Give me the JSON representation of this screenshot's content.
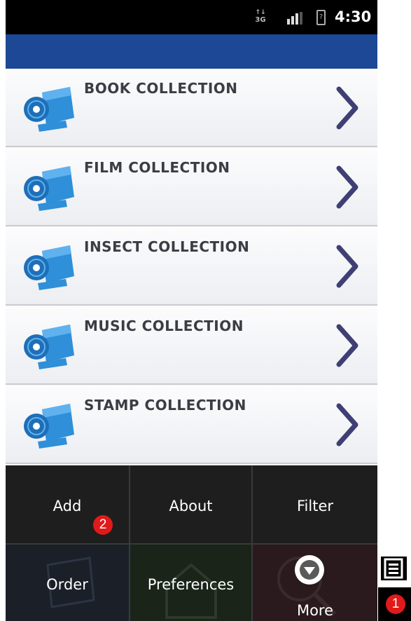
{
  "status_bar": {
    "network": "3G",
    "time": "4:30",
    "battery_glyph": "?"
  },
  "list": {
    "items": [
      {
        "label": "BOOK COLLECTION"
      },
      {
        "label": "FILM COLLECTION"
      },
      {
        "label": "INSECT COLLECTION"
      },
      {
        "label": "MUSIC COLLECTION"
      },
      {
        "label": "STAMP COLLECTION"
      }
    ]
  },
  "menu": {
    "add": "Add",
    "about": "About",
    "filter": "Filter",
    "order": "Order",
    "preferences": "Preferences",
    "more": "More"
  },
  "annotations": {
    "badge_1": "1",
    "badge_2": "2"
  },
  "colors": {
    "title_bar": "#1c4896",
    "chevron": "#3f3f75",
    "icon_blue": "#2f8fd8",
    "badge": "#e01a1a",
    "menu_bg": "#1e1e1e"
  },
  "icons": {
    "collection": "disc-folder-icon",
    "chevron": "chevron-right-icon",
    "more": "chevron-down-circle-icon",
    "menu_key": "hamburger-menu-icon"
  }
}
